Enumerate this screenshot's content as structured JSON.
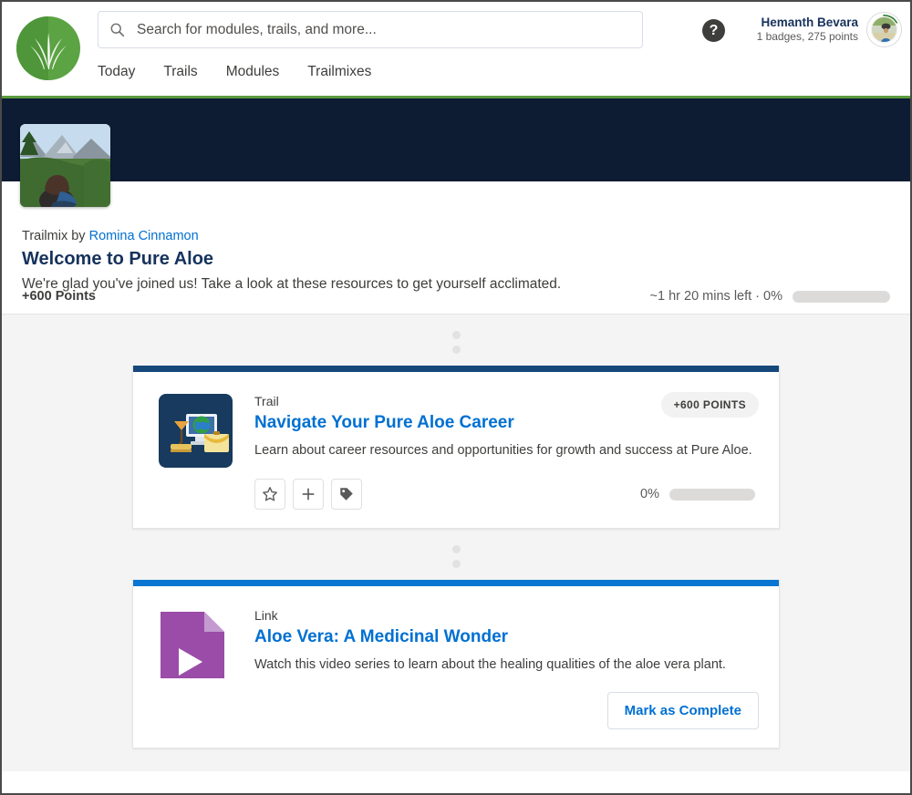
{
  "header": {
    "logo_name": "trailhead-logo",
    "search": {
      "placeholder": "Search for modules, trails, and more...",
      "value": "",
      "icon": "search-icon"
    },
    "help_label": "?",
    "user": {
      "name": "Hemanth Bevara",
      "stats": "1 badges, 275 points"
    },
    "nav": [
      {
        "label": "Today"
      },
      {
        "label": "Trails"
      },
      {
        "label": "Modules"
      },
      {
        "label": "Trailmixes"
      }
    ]
  },
  "trailmix": {
    "byline_prefix": "Trailmix by",
    "author": "Romina Cinnamon",
    "title": "Welcome to Pure Aloe",
    "description": "We're glad you've joined us! Take a look at these resources to get yourself acclimated.",
    "points": "+600 Points",
    "time_left": "~1 hr 20 mins left · 0%",
    "progress_percent": 0
  },
  "items": [
    {
      "kicker": "Trail",
      "title": "Navigate Your Pure Aloe Career",
      "description": "Learn about career resources and opportunities for growth and success at Pure Aloe.",
      "points_badge": "+600 POINTS",
      "progress_label": "0%",
      "progress_percent": 0,
      "bar_color": "#16487a",
      "icon": "trail-desk-icon",
      "actions": [
        {
          "name": "favorite-button",
          "icon": "star-icon"
        },
        {
          "name": "add-button",
          "icon": "plus-icon"
        },
        {
          "name": "tag-button",
          "icon": "tag-icon"
        }
      ]
    },
    {
      "kicker": "Link",
      "title": "Aloe Vera: A Medicinal Wonder",
      "description": "Watch this video series to learn about the healing qualities of the aloe vera plant.",
      "bar_color": "#0b76d1",
      "icon": "video-link-icon",
      "mark_complete_label": "Mark as Complete"
    }
  ],
  "colors": {
    "brand_green": "#5ba343",
    "banner_navy": "#0d1c33",
    "link_blue": "#0070d2",
    "page_bg": "#f4f4f4"
  }
}
